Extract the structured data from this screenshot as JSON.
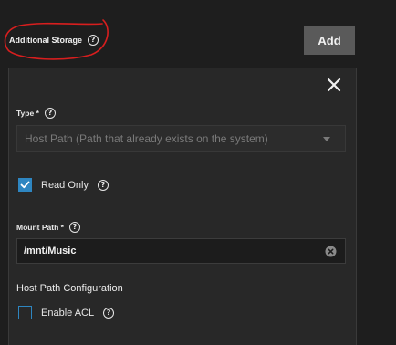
{
  "storage": {
    "title": "Additional Storage",
    "add_label": "Add"
  },
  "form": {
    "type_label": "Type *",
    "type_value": "Host Path (Path that already exists on the system)",
    "read_only_label": "Read Only",
    "read_only_checked": true,
    "mount_path_label": "Mount Path *",
    "mount_path_value": "/mnt/Music",
    "host_path_section": "Host Path Configuration",
    "enable_acl_label": "Enable ACL",
    "enable_acl_checked": false
  },
  "colors": {
    "accent": "#2e86c1",
    "annotation": "#d81e1e"
  },
  "icons": {
    "help": "help-circle-icon",
    "close": "close-icon",
    "clear": "clear-circle-icon",
    "dropdown": "chevron-down-icon",
    "check": "check-icon"
  }
}
